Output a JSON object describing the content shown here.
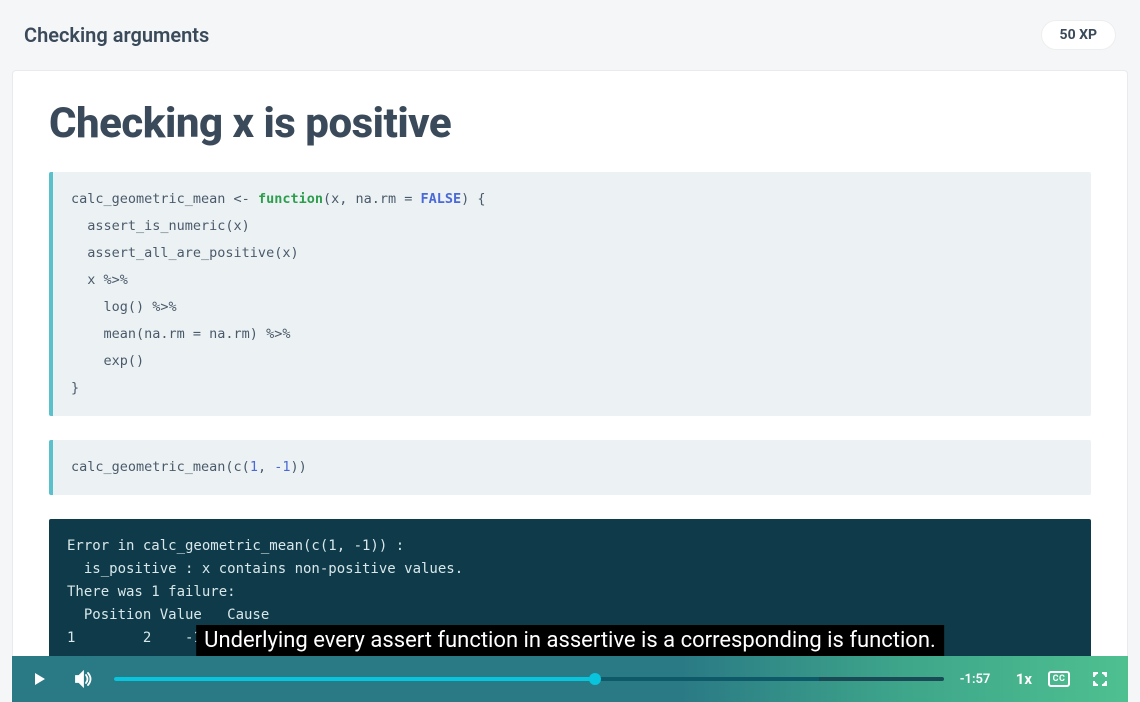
{
  "header": {
    "title": "Checking arguments",
    "xp": "50 XP"
  },
  "slide": {
    "title": "Checking x is positive",
    "code1_html": "calc_geometric_mean <- <span class='kw'>function</span>(x, na.rm = <span class='boolval'>FALSE</span>) {\n  assert_is_numeric(x)\n  assert_all_are_positive(x)\n  x %>%\n    log() %>%\n    mean(na.rm = na.rm) %>%\n    exp()\n}",
    "code2_html": "calc_geometric_mean(c(<span class='num'>1</span>, <span class='num'>-1</span>))",
    "output": "Error in calc_geometric_mean(c(1, -1)) :\n  is_positive : x contains non-positive values.\nThere was 1 failure:\n  Position Value   Cause\n1        2    -1 too low"
  },
  "caption": "Underlying every assert function in assertive is a corresponding is function.",
  "player": {
    "time_remaining": "-1:57",
    "speed": "1x",
    "cc": "CC",
    "progress_pct": 58,
    "buffer_start_pct": 58,
    "buffer_end_pct": 85
  }
}
